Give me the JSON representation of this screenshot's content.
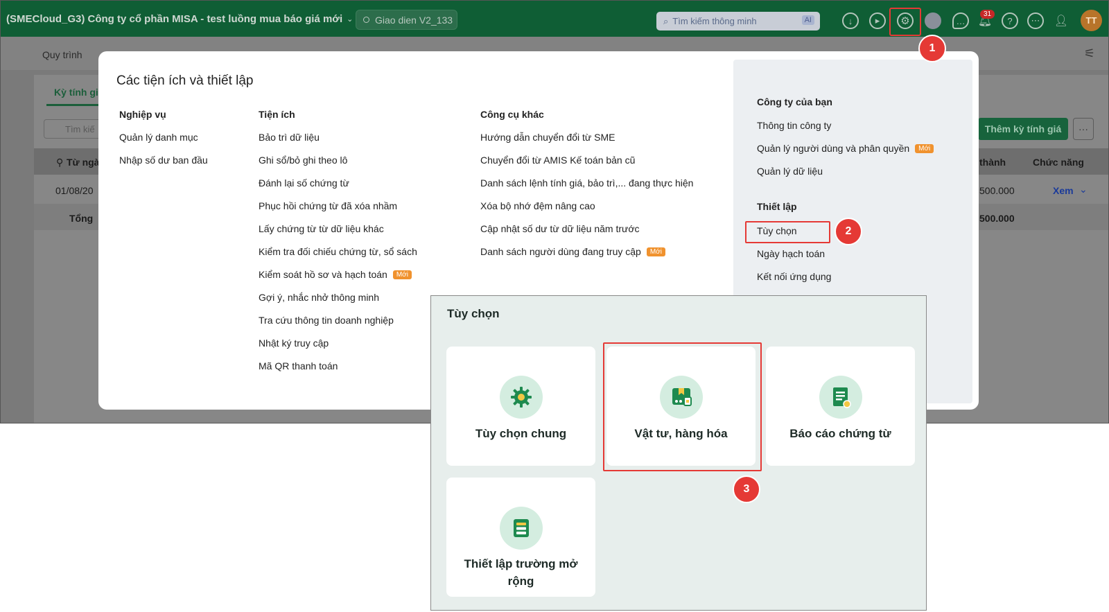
{
  "topbar": {
    "company_title": "(SMECloud_G3) Công ty cổ phần MISA - test luồng mua báo giá mới",
    "ui_version": "Giao dien V2_133",
    "search_placeholder": "Tìm kiếm thông minh",
    "search_ai_tag": "AI",
    "notification_count": "31",
    "avatar_initials": "TT"
  },
  "subnav": {
    "process_label": "Quy trình"
  },
  "background": {
    "tab_label": "Kỳ tính giá",
    "search_placeholder": "Tìm kiế",
    "add_button": "Thêm kỳ tính giá",
    "more_button": "···",
    "headers": {
      "from_date": "Từ ngày",
      "total_col": "thành",
      "actions": "Chức năng"
    },
    "row": {
      "date": "01/08/20",
      "amount": "500.000",
      "view": "Xem"
    },
    "sum_row": {
      "label": "Tổng",
      "amount": "500.000"
    }
  },
  "modal": {
    "title": "Các tiện ích và thiết lập",
    "col1": {
      "header": "Nghiệp vụ",
      "items": [
        "Quản lý danh mục",
        "Nhập số dư ban đầu"
      ]
    },
    "col2": {
      "header": "Tiện ích",
      "items": [
        "Bảo trì dữ liệu",
        "Ghi sổ/bỏ ghi theo lô",
        "Đánh lại số chứng từ",
        "Phục hồi chứng từ đã xóa nhầm",
        "Lấy chứng từ từ dữ liệu khác",
        "Kiểm tra đối chiếu chứng từ, sổ sách",
        "Kiểm soát hồ sơ và hạch toán",
        "Gợi ý, nhắc nhở thông minh",
        "Tra cứu thông tin doanh nghiệp",
        "Nhật ký truy cập",
        "Mã QR thanh toán"
      ]
    },
    "col3": {
      "header": "Công cụ khác",
      "items": [
        "Hướng dẫn chuyển đổi từ SME",
        "Chuyển đổi từ AMIS Kế toán bản cũ",
        "Danh sách lệnh tính giá, bảo trì,... đang thực hiện",
        "Xóa bộ nhớ đệm nâng cao",
        "Cập nhật số dư từ dữ liệu năm trước",
        "Danh sách người dùng đang truy cập"
      ]
    },
    "new_tag": "Mới",
    "right": {
      "company_header": "Công ty của bạn",
      "company_items": [
        "Thông tin công ty",
        "Quản lý người dùng và phân quyền",
        "Quản lý dữ liệu"
      ],
      "settings_header": "Thiết lập",
      "settings_items": [
        "Tùy chọn",
        "Ngày hạch toán",
        "Kết nối ứng dụng"
      ]
    }
  },
  "options": {
    "title": "Tùy chọn",
    "cards": [
      "Tùy chọn chung",
      "Vật tư, hàng hóa",
      "Báo cáo chứng từ",
      "Thiết lập trường mở rộng"
    ]
  },
  "steps": [
    "1",
    "2",
    "3"
  ],
  "colors": {
    "brand_green": "#0f5e35",
    "highlight_red": "#e53935",
    "new_tag": "#f0922e",
    "icon_green": "#1e8a4f"
  }
}
